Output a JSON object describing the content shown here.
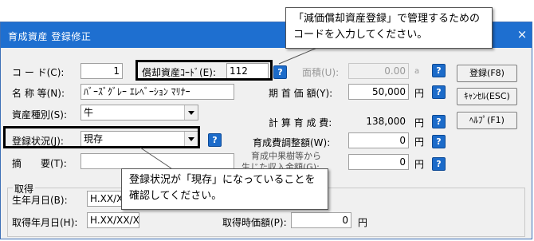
{
  "window": {
    "title": "育成資産 登録修正",
    "close_glyph": "×"
  },
  "fields": {
    "code": {
      "label": "コ ー ド(C):",
      "value": "1"
    },
    "depreciation_code": {
      "label": "償却資産ｺｰﾄﾞ(E):",
      "value": "112"
    },
    "area": {
      "label": "面積(U):",
      "value": "0.00",
      "unit": "a"
    },
    "name": {
      "label": "名 称 等(N):",
      "value": "ﾊﾞｰｽﾞｸﾞﾚｰ ｴﾚﾍﾞｰｼｮﾝ ﾏﾘﾅｰ"
    },
    "initial_price": {
      "label": "期 首 価 額(Y):",
      "value": "50,000",
      "unit": "円"
    },
    "asset_type": {
      "label": "資産種別(S):",
      "value": "牛"
    },
    "total_cost": {
      "label": "計 算 育 成 費:",
      "value": "138,000",
      "unit": "円"
    },
    "status": {
      "label": "登録状況(J):",
      "value": "現存"
    },
    "cost_adjustment": {
      "label": "育成費調整額(W):",
      "value": "0",
      "unit": "円"
    },
    "summary": {
      "label": "摘　　要(T):",
      "value": ""
    },
    "income": {
      "label_line1": "育成中果樹等から",
      "label_line2": "生じた収入金額(G):",
      "value": "0",
      "unit": "円"
    }
  },
  "acquisition": {
    "group_label": "取得",
    "birth_date": {
      "label": "生年月日(B):",
      "value": "H.XX/XX"
    },
    "acquire_date": {
      "label": "取得年月日(H):",
      "value": "H.XX/XX/XX"
    },
    "acquire_price": {
      "label": "取得時価額(P):",
      "value": "0",
      "unit": "円"
    }
  },
  "buttons": {
    "register": "登録(F8)",
    "cancel": "ｷｬﾝｾﾙ(ESC)",
    "help": "ﾍﾙﾌﾟ(F1)"
  },
  "help_glyph": "?",
  "callouts": {
    "top": {
      "line1": "「減価償却資産登録」で管理するための",
      "line2": "コードを入力してください。"
    },
    "bottom": {
      "line1": "登録状況が「現存」になっていることを",
      "line2": "確認してください。"
    }
  },
  "colors": {
    "title_bar": "#1e6fd0",
    "help_icon": "#1c6bc9",
    "window_bg": "#f0f0f0"
  }
}
